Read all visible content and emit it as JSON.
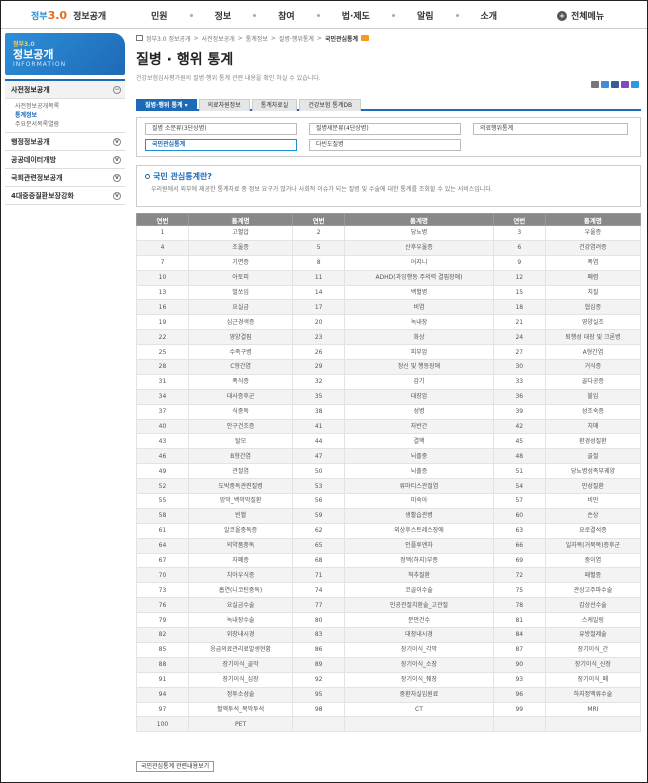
{
  "header": {
    "logo_mark": "정부",
    "logo_num": "3.0",
    "logo_text": "정보공개",
    "nav": [
      "민원",
      "정보",
      "참여",
      "법·제도",
      "알림",
      "소개"
    ],
    "all_menu": "전체메뉴"
  },
  "sidebar": {
    "banner_small": "정부3.0",
    "banner_title": "정보공개",
    "banner_en": "INFORMATION",
    "items": [
      {
        "label": "사전정보공개",
        "active": true,
        "subs": [
          "사전정보공개목록",
          "통계정보",
          "주요문서목록열람"
        ],
        "current": 1
      },
      {
        "label": "행정정보공개"
      },
      {
        "label": "공공데이터개방"
      },
      {
        "label": "국회관련정보공개"
      },
      {
        "label": "4대중증질환보장강화"
      }
    ]
  },
  "breadcrumb": [
    "정부3.0 정보공개",
    "사전정보공개",
    "통계정보",
    "질병·행위통계",
    "국민관심통계"
  ],
  "page_title": "질병 · 행위 통계",
  "page_desc": "건강보험심사평가원의 질병·행위 통계 관련 내용을 확인 하실 수 있습니다.",
  "tabs": [
    "질병·행위 통계 ▾",
    "의료자원정보",
    "통계자료실",
    "건강보험 통계DB"
  ],
  "subtabs": [
    "질병 소분류(3단상병)",
    "질병세분류(4단상병)",
    "의료행위통계",
    "국민관심통계",
    "다빈도질병"
  ],
  "info": {
    "heading": "국민 관심통계란?",
    "body": "우리원에서 외부에 제공한 통계자료 중 정보 요구가 많거나 사회적 이슈가 되는 질병 및 수술에 대한 통계를 조회할 수 있는 서비스입니다."
  },
  "table": {
    "headers": [
      "연번",
      "통계명",
      "연번",
      "통계명",
      "연번",
      "통계명"
    ],
    "rows": [
      [
        "1",
        "고혈압",
        "2",
        "당뇨병",
        "3",
        "우울증"
      ],
      [
        "4",
        "조울증",
        "5",
        "산후우울증",
        "6",
        "건강염려증"
      ],
      [
        "7",
        "기면증",
        "8",
        "어지니",
        "9",
        "폭염"
      ],
      [
        "10",
        "아토피",
        "11",
        "ADHD(과잉행동 주의력 결핍장애)",
        "12",
        "폐렴"
      ],
      [
        "13",
        "벌쏘임",
        "14",
        "백혈병",
        "15",
        "치질"
      ],
      [
        "16",
        "요실금",
        "17",
        "비염",
        "18",
        "협심증"
      ],
      [
        "19",
        "심근경색증",
        "20",
        "녹내장",
        "21",
        "영양실조"
      ],
      [
        "22",
        "영양결핍",
        "23",
        "화상",
        "24",
        "퇴행성 대장 및 크론병"
      ],
      [
        "25",
        "수족구병",
        "26",
        "피부암",
        "27",
        "A형간염"
      ],
      [
        "28",
        "C형간염",
        "29",
        "정신 및 행동장애",
        "30",
        "거식증"
      ],
      [
        "31",
        "폭식증",
        "32",
        "감기",
        "33",
        "골다공증"
      ],
      [
        "34",
        "대사증후군",
        "35",
        "대장암",
        "36",
        "불임"
      ],
      [
        "37",
        "식중독",
        "38",
        "성병",
        "39",
        "성조숙증"
      ],
      [
        "40",
        "안구건조증",
        "41",
        "자반간",
        "42",
        "치매"
      ],
      [
        "43",
        "탈모",
        "44",
        "결핵",
        "45",
        "환경성질환"
      ],
      [
        "46",
        "B형간염",
        "47",
        "뇌졸중",
        "48",
        "골절"
      ],
      [
        "49",
        "관절염",
        "50",
        "뇌출증",
        "51",
        "당뇨병성족부궤양"
      ],
      [
        "52",
        "도박중독관련질병",
        "53",
        "류마티스관절염",
        "54",
        "만성질환"
      ],
      [
        "55",
        "망막_백막막질환",
        "56",
        "미숙아",
        "57",
        "비만"
      ],
      [
        "58",
        "빈혈",
        "59",
        "생활습관병",
        "60",
        "손상"
      ],
      [
        "61",
        "알코올중독증",
        "62",
        "외상후스트레스장애",
        "63",
        "요로결석증"
      ],
      [
        "64",
        "의약품중독",
        "65",
        "인플루엔자",
        "66",
        "일자목(거북목)증후군"
      ],
      [
        "67",
        "자폐증",
        "68",
        "정맥(하지)부종",
        "69",
        "중이염"
      ],
      [
        "70",
        "치아우식증",
        "71",
        "척추질환",
        "72",
        "패혈증"
      ],
      [
        "73",
        "흡연(니코틴중독)",
        "74",
        "코골이수술",
        "75",
        "관상고주파수술"
      ],
      [
        "76",
        "요실금수술",
        "77",
        "인공관절치환술_고관절",
        "78",
        "갑상선수술"
      ],
      [
        "79",
        "녹내장수술",
        "80",
        "분만건수",
        "81",
        "스케일링"
      ],
      [
        "82",
        "위장내시경",
        "83",
        "대장내시경",
        "84",
        "유방절제술"
      ],
      [
        "85",
        "응급의료관리료발생현황",
        "86",
        "장기이식_각막",
        "87",
        "장기이식_간"
      ],
      [
        "88",
        "장기이식_골막",
        "89",
        "장기이식_소장",
        "90",
        "장기이식_신장"
      ],
      [
        "91",
        "장기이식_심장",
        "92",
        "장기이식_췌장",
        "93",
        "장기이식_폐"
      ],
      [
        "94",
        "정투소성술",
        "95",
        "중환자실입원료",
        "96",
        "하지정맥류수술"
      ],
      [
        "97",
        "혈액투석_복막투석",
        "98",
        "CT",
        "99",
        "MRI"
      ],
      [
        "100",
        "PET",
        "",
        "",
        "",
        ""
      ]
    ]
  },
  "bottom_button": "국민관심통계 관련내용보기"
}
